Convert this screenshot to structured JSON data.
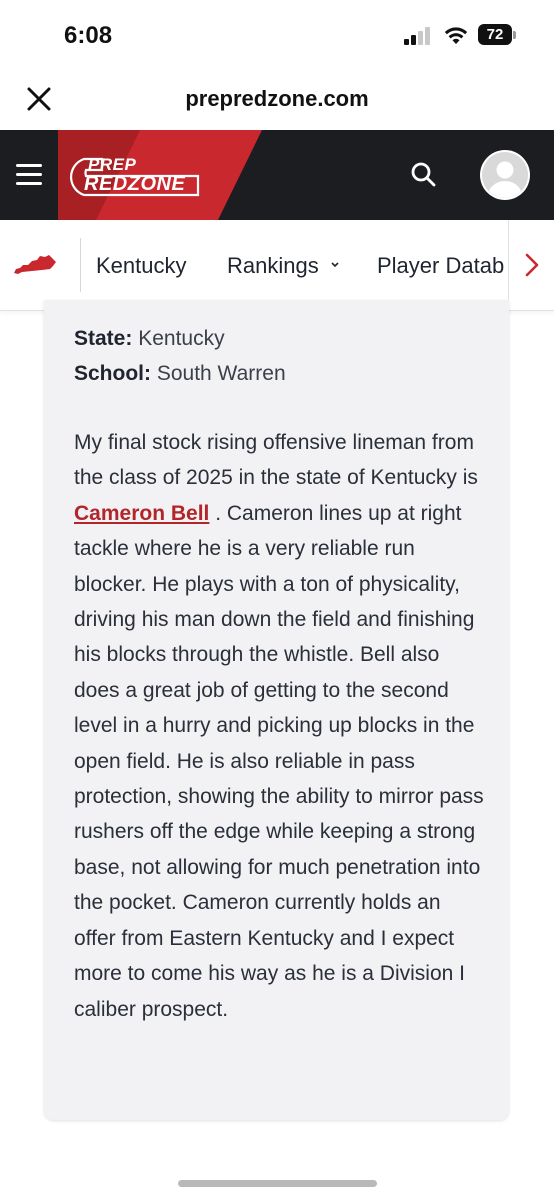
{
  "status_bar": {
    "time": "6:08",
    "battery": "72",
    "icons": [
      "signal-icon",
      "wifi-icon",
      "battery-icon"
    ]
  },
  "browser": {
    "url": "prepredzone.com",
    "close_icon": "close-icon"
  },
  "header": {
    "logo_line1": "PREP",
    "logo_line2": "REDZONE",
    "menu_icon": "hamburger-icon",
    "search_icon": "search-icon",
    "avatar_icon": "user-avatar-icon",
    "colors": {
      "background": "#1c1d21",
      "brand_red": "#c8282e"
    }
  },
  "subnav": {
    "state_icon": "kentucky-map-icon",
    "items": [
      {
        "label": "Kentucky"
      },
      {
        "label": "Rankings"
      },
      {
        "label": "Player Datab"
      }
    ],
    "next_icon": "chevron-right-icon"
  },
  "article": {
    "state_label": "State:",
    "state_value": "Kentucky",
    "school_label": "School:",
    "school_value": "South Warren",
    "body_before_link": "My final stock rising offensive lineman from the class of 2025 in the state of Kentucky is ",
    "player_name": "Cameron Bell",
    "body_after_link": " . Cameron lines up at right tackle where he is a very reliable run blocker. He plays with a ton of physicality, driving his man down the field and finishing his blocks through the whistle. Bell also does a great job of getting to the second level in a hurry and picking up blocks in the open field. He is also reliable in pass protection, showing the ability to mirror pass rushers off the edge while keeping a strong base, not allowing for much penetration into the pocket. Cameron currently holds an offer from Eastern Kentucky and I expect more to come his way as he is a Division I caliber prospect.",
    "link_color": "#b2262a"
  }
}
